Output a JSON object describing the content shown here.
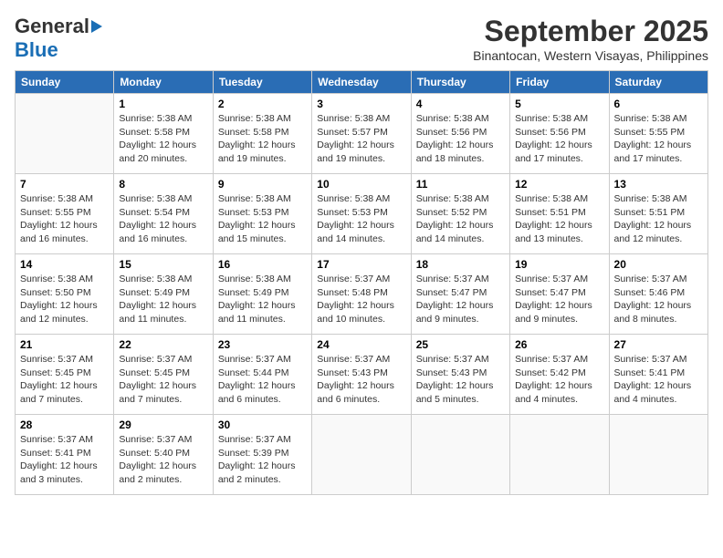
{
  "header": {
    "logo_general": "General",
    "logo_blue": "Blue",
    "month_year": "September 2025",
    "location": "Binantocan, Western Visayas, Philippines"
  },
  "days_of_week": [
    "Sunday",
    "Monday",
    "Tuesday",
    "Wednesday",
    "Thursday",
    "Friday",
    "Saturday"
  ],
  "weeks": [
    [
      {
        "day": "",
        "info": ""
      },
      {
        "day": "1",
        "info": "Sunrise: 5:38 AM\nSunset: 5:58 PM\nDaylight: 12 hours\nand 20 minutes."
      },
      {
        "day": "2",
        "info": "Sunrise: 5:38 AM\nSunset: 5:58 PM\nDaylight: 12 hours\nand 19 minutes."
      },
      {
        "day": "3",
        "info": "Sunrise: 5:38 AM\nSunset: 5:57 PM\nDaylight: 12 hours\nand 19 minutes."
      },
      {
        "day": "4",
        "info": "Sunrise: 5:38 AM\nSunset: 5:56 PM\nDaylight: 12 hours\nand 18 minutes."
      },
      {
        "day": "5",
        "info": "Sunrise: 5:38 AM\nSunset: 5:56 PM\nDaylight: 12 hours\nand 17 minutes."
      },
      {
        "day": "6",
        "info": "Sunrise: 5:38 AM\nSunset: 5:55 PM\nDaylight: 12 hours\nand 17 minutes."
      }
    ],
    [
      {
        "day": "7",
        "info": "Sunrise: 5:38 AM\nSunset: 5:55 PM\nDaylight: 12 hours\nand 16 minutes."
      },
      {
        "day": "8",
        "info": "Sunrise: 5:38 AM\nSunset: 5:54 PM\nDaylight: 12 hours\nand 16 minutes."
      },
      {
        "day": "9",
        "info": "Sunrise: 5:38 AM\nSunset: 5:53 PM\nDaylight: 12 hours\nand 15 minutes."
      },
      {
        "day": "10",
        "info": "Sunrise: 5:38 AM\nSunset: 5:53 PM\nDaylight: 12 hours\nand 14 minutes."
      },
      {
        "day": "11",
        "info": "Sunrise: 5:38 AM\nSunset: 5:52 PM\nDaylight: 12 hours\nand 14 minutes."
      },
      {
        "day": "12",
        "info": "Sunrise: 5:38 AM\nSunset: 5:51 PM\nDaylight: 12 hours\nand 13 minutes."
      },
      {
        "day": "13",
        "info": "Sunrise: 5:38 AM\nSunset: 5:51 PM\nDaylight: 12 hours\nand 12 minutes."
      }
    ],
    [
      {
        "day": "14",
        "info": "Sunrise: 5:38 AM\nSunset: 5:50 PM\nDaylight: 12 hours\nand 12 minutes."
      },
      {
        "day": "15",
        "info": "Sunrise: 5:38 AM\nSunset: 5:49 PM\nDaylight: 12 hours\nand 11 minutes."
      },
      {
        "day": "16",
        "info": "Sunrise: 5:38 AM\nSunset: 5:49 PM\nDaylight: 12 hours\nand 11 minutes."
      },
      {
        "day": "17",
        "info": "Sunrise: 5:37 AM\nSunset: 5:48 PM\nDaylight: 12 hours\nand 10 minutes."
      },
      {
        "day": "18",
        "info": "Sunrise: 5:37 AM\nSunset: 5:47 PM\nDaylight: 12 hours\nand 9 minutes."
      },
      {
        "day": "19",
        "info": "Sunrise: 5:37 AM\nSunset: 5:47 PM\nDaylight: 12 hours\nand 9 minutes."
      },
      {
        "day": "20",
        "info": "Sunrise: 5:37 AM\nSunset: 5:46 PM\nDaylight: 12 hours\nand 8 minutes."
      }
    ],
    [
      {
        "day": "21",
        "info": "Sunrise: 5:37 AM\nSunset: 5:45 PM\nDaylight: 12 hours\nand 7 minutes."
      },
      {
        "day": "22",
        "info": "Sunrise: 5:37 AM\nSunset: 5:45 PM\nDaylight: 12 hours\nand 7 minutes."
      },
      {
        "day": "23",
        "info": "Sunrise: 5:37 AM\nSunset: 5:44 PM\nDaylight: 12 hours\nand 6 minutes."
      },
      {
        "day": "24",
        "info": "Sunrise: 5:37 AM\nSunset: 5:43 PM\nDaylight: 12 hours\nand 6 minutes."
      },
      {
        "day": "25",
        "info": "Sunrise: 5:37 AM\nSunset: 5:43 PM\nDaylight: 12 hours\nand 5 minutes."
      },
      {
        "day": "26",
        "info": "Sunrise: 5:37 AM\nSunset: 5:42 PM\nDaylight: 12 hours\nand 4 minutes."
      },
      {
        "day": "27",
        "info": "Sunrise: 5:37 AM\nSunset: 5:41 PM\nDaylight: 12 hours\nand 4 minutes."
      }
    ],
    [
      {
        "day": "28",
        "info": "Sunrise: 5:37 AM\nSunset: 5:41 PM\nDaylight: 12 hours\nand 3 minutes."
      },
      {
        "day": "29",
        "info": "Sunrise: 5:37 AM\nSunset: 5:40 PM\nDaylight: 12 hours\nand 2 minutes."
      },
      {
        "day": "30",
        "info": "Sunrise: 5:37 AM\nSunset: 5:39 PM\nDaylight: 12 hours\nand 2 minutes."
      },
      {
        "day": "",
        "info": ""
      },
      {
        "day": "",
        "info": ""
      },
      {
        "day": "",
        "info": ""
      },
      {
        "day": "",
        "info": ""
      }
    ]
  ]
}
